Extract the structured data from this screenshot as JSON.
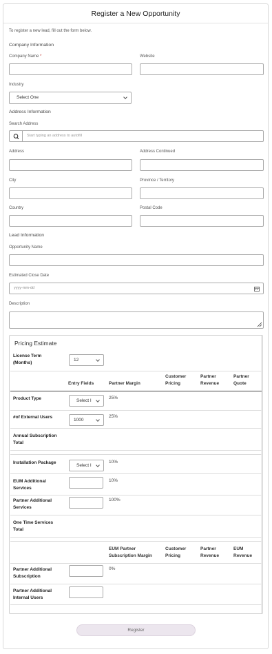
{
  "title": "Register a New Opportunity",
  "intro": "To register a new lead, fill out the form below.",
  "company_section": "Company Information",
  "company_name_label": "Company Name",
  "company_name_required": "*",
  "website_label": "Website",
  "industry_label": "Industry",
  "industry_value": "Select One",
  "address_section": "Address Information",
  "search_address_label": "Search Address",
  "search_placeholder": "Start typing an address to autofill",
  "address_label": "Address",
  "address_continued_label": "Address Continued",
  "city_label": "City",
  "province_label": "Province / Territory",
  "country_label": "Country",
  "postal_label": "Postal Code",
  "lead_section": "Lead Information",
  "opportunity_name_label": "Opportunity Name",
  "close_date_label": "Estimated Close Date",
  "close_date_placeholder": "yyyy-mm-dd",
  "description_label": "Description",
  "pricing": {
    "title": "Pricing Estimate",
    "license_term_label": "License Term (Months)",
    "license_term_value": "12",
    "headers": {
      "entry_fields": "Entry Fields",
      "partner_margin": "Partner Margin",
      "customer_pricing": "Customer Pricing",
      "partner_revenue": "Partner Revenue",
      "partner_quote": "Partner Quote"
    },
    "product_type_label": "Product Type",
    "product_type_value": "Select I",
    "product_type_margin": "25%",
    "external_users_label": "#of External Users",
    "external_users_value": "1000",
    "external_users_margin": "25%",
    "annual_total_label": "Annual Subscription Total",
    "installation_label": "Installation Package",
    "installation_value": "Select I",
    "installation_margin": "10%",
    "eum_services_label": "EUM Additional Services",
    "eum_services_margin": "10%",
    "partner_services_label": "Partner Additional Services",
    "partner_services_margin": "100%",
    "one_time_total_label": "One Time Services Total",
    "headers2": {
      "eum_partner_margin": "EUM Partner Subscription Margin",
      "customer_pricing": "Customer Pricing",
      "partner_revenue": "Partner Revenue",
      "eum_revenue": "EUM Revenue"
    },
    "partner_subscription_label": "Partner Additional Subscription",
    "partner_subscription_margin": "0%",
    "partner_internal_users_label": "Partner Additional Internal Users"
  },
  "register_label": "Register"
}
